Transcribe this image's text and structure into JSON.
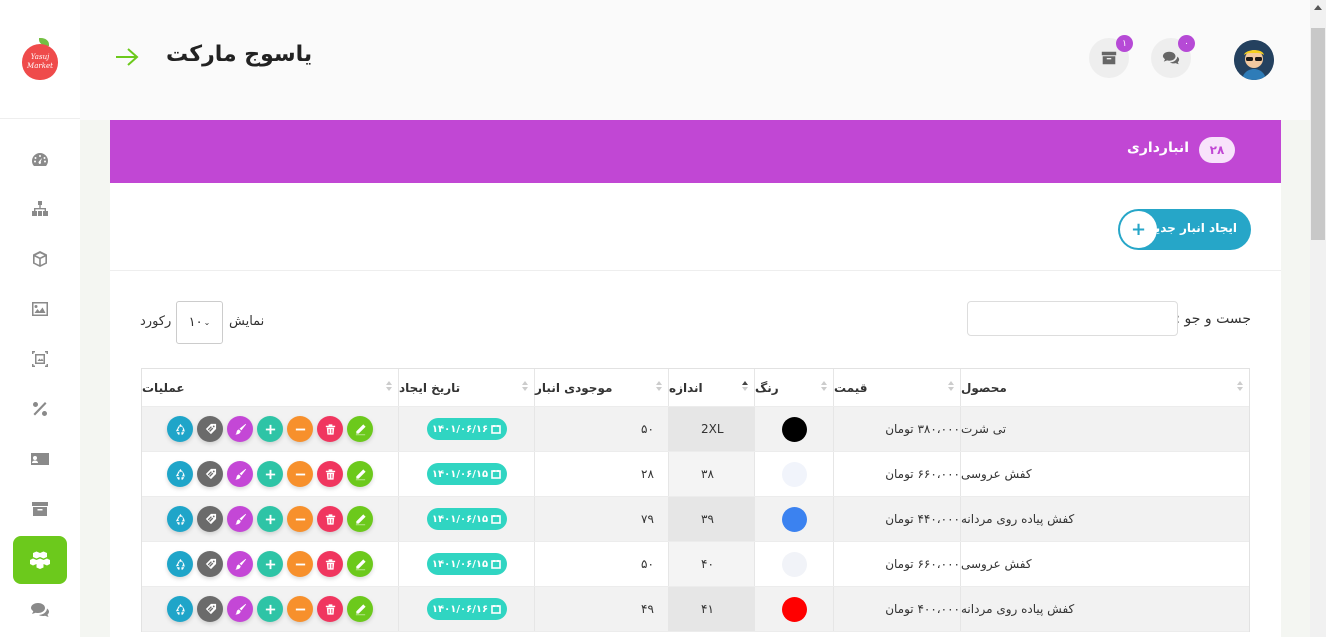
{
  "header": {
    "title": "یاسوج مارکت",
    "inbox_badge": "۱",
    "chat_badge": "۰",
    "logo_text": "Yasuj Market"
  },
  "sidebar": {
    "items": [
      {
        "name": "dashboard-icon",
        "active": false
      },
      {
        "name": "sitemap-icon",
        "active": false
      },
      {
        "name": "box-icon",
        "active": false
      },
      {
        "name": "image-icon",
        "active": false
      },
      {
        "name": "frame-icon",
        "active": false
      },
      {
        "name": "percent-icon",
        "active": false
      },
      {
        "name": "id-card-icon",
        "active": false
      },
      {
        "name": "archive-icon",
        "active": false
      },
      {
        "name": "cubes-icon",
        "active": true
      },
      {
        "name": "comments-icon",
        "active": false
      }
    ]
  },
  "panel": {
    "title": "انبارداری",
    "count": "۲۸",
    "create_label": "ایجاد انبار جدید",
    "create_icon": "+",
    "search_label": "جست و جو :",
    "show_label": "نمایش",
    "records_label": "رکورد",
    "page_length": "۱۰"
  },
  "table": {
    "columns": [
      "محصول",
      "قیمت",
      "رنگ",
      "اندازه",
      "موجودی انبار",
      "تاریخ ایجاد",
      "عملیات"
    ],
    "rows": [
      {
        "product": "تی شرت",
        "price": "۳۸۰،۰۰۰ تومان",
        "color": "#000000",
        "size": "2XL",
        "stock": "۵۰",
        "date": "۱۴۰۱/۰۶/۱۶"
      },
      {
        "product": "کفش عروسی",
        "price": "۶۶۰،۰۰۰ تومان",
        "color": "#f1f4fb",
        "size": "۳۸",
        "stock": "۲۸",
        "date": "۱۴۰۱/۰۶/۱۵"
      },
      {
        "product": "کفش پیاده روی مردانه",
        "price": "۴۴۰،۰۰۰ تومان",
        "color": "#3b82f0",
        "size": "۳۹",
        "stock": "۷۹",
        "date": "۱۴۰۱/۰۶/۱۵"
      },
      {
        "product": "کفش عروسی",
        "price": "۶۶۰،۰۰۰ تومان",
        "color": "#f1f3f8",
        "size": "۴۰",
        "stock": "۵۰",
        "date": "۱۴۰۱/۰۶/۱۵"
      },
      {
        "product": "کفش پیاده روی مردانه",
        "price": "۴۰۰،۰۰۰ تومان",
        "color": "#ff0000",
        "size": "۴۱",
        "stock": "۴۹",
        "date": "۱۴۰۱/۰۶/۱۶"
      }
    ],
    "sorted_column": "اندازه"
  },
  "colors": {
    "accent": "#c147d4",
    "active_nav": "#6cc91c",
    "create_button": "#26a6c8",
    "date_pill": "#30d5c2"
  }
}
